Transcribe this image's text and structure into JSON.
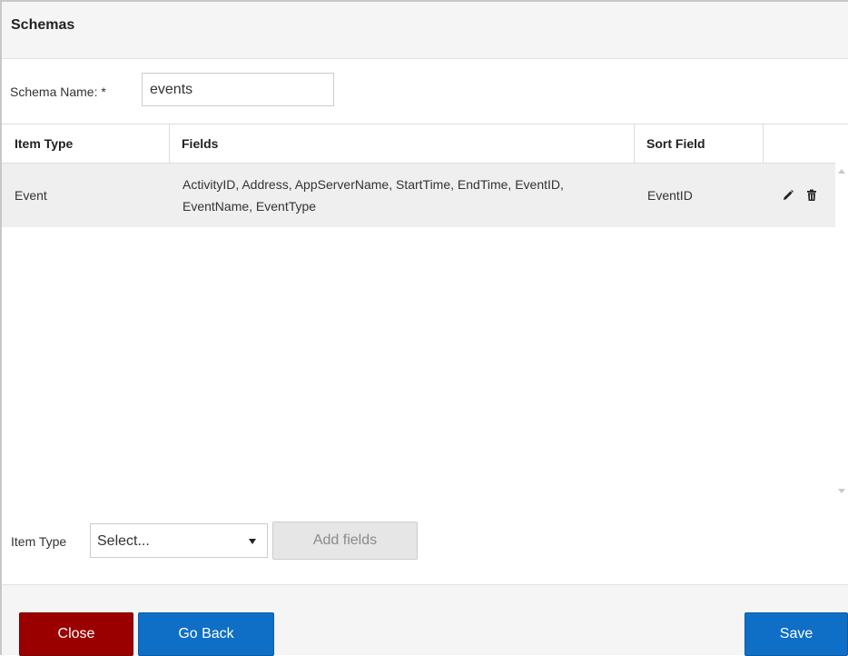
{
  "dialog": {
    "title": "Schemas"
  },
  "schema": {
    "name_label": "Schema Name: *",
    "name_value": "events"
  },
  "grid": {
    "headers": {
      "item_type": "Item Type",
      "fields": "Fields",
      "sort_field": "Sort Field"
    },
    "rows": [
      {
        "item_type": "Event",
        "fields": "ActivityID, Address, AppServerName, StartTime, EndTime, EventID, EventName, EventType",
        "sort_field": "EventID"
      }
    ]
  },
  "add_row": {
    "item_type_label": "Item Type",
    "select_value": "Select...",
    "add_fields_label": "Add fields"
  },
  "footer": {
    "close_label": "Close",
    "go_back_label": "Go Back",
    "save_label": "Save"
  },
  "colors": {
    "close_button": "#9b0000",
    "primary_button": "#0f6fc6",
    "disabled_button": "#e6e6e6"
  },
  "icons": {
    "edit": "pencil-icon",
    "delete": "trash-icon"
  }
}
